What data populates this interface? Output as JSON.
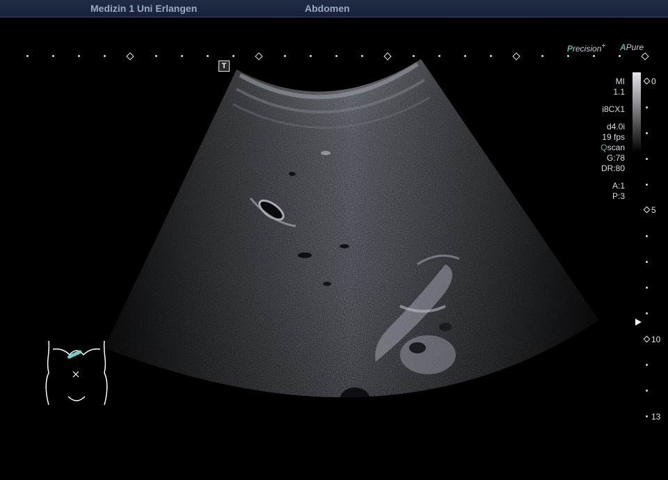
{
  "header": {
    "institution": "Medizin 1 Uni Erlangen",
    "preset": "Abdomen"
  },
  "logos": {
    "precision_prefix": "P",
    "precision_rest": "recision",
    "precision_sup": "+",
    "apure_prefix": "A",
    "apure_rest": "Pure"
  },
  "orientation_marker": "T",
  "params": {
    "mi_label": "MI",
    "mi_value": "1.1",
    "probe": "i8CX1",
    "freq": "d4.0i",
    "fps": "19 fps",
    "qscan_q": "Q",
    "qscan_rest": "scan",
    "gain": "G:78",
    "dynamic_range": "DR:80",
    "a": "A:1",
    "p": "P:3"
  },
  "depth_scale": {
    "labels": [
      "0",
      "5",
      "10",
      "13"
    ]
  },
  "colors": {
    "accent_teal": "#58b4ad",
    "header_bg": "#1f2c44"
  },
  "icons": {
    "orientation": "t-marker-icon",
    "bodymark": "abdomen-bodymark-icon",
    "focus": "focus-arrow-icon"
  }
}
